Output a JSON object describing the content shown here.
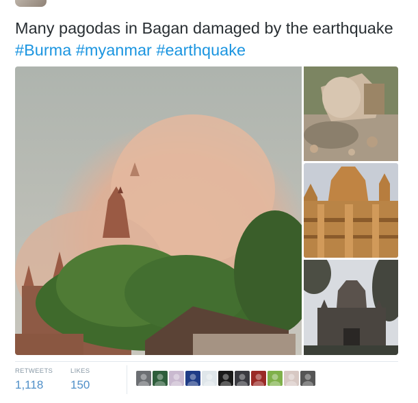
{
  "tweet": {
    "text": {
      "plain": "Many pagodas in Bagan damaged by the earthquake ",
      "hashtags": [
        "#Burma",
        "#myanmar",
        "#earthquake"
      ]
    },
    "photos": [
      {
        "name": "pagoda-dust-cloud-photo"
      },
      {
        "name": "broken-stupa-finial-photo"
      },
      {
        "name": "damaged-pagoda-spires-photo"
      },
      {
        "name": "temple-silhouette-photo"
      }
    ]
  },
  "stats": {
    "retweets": {
      "label": "RETWEETS",
      "value": "1,118"
    },
    "likes": {
      "label": "LIKES",
      "value": "150"
    }
  },
  "likers": [
    {
      "name": "liker-avatar-1",
      "color": "#6c6f73"
    },
    {
      "name": "liker-avatar-2",
      "color": "#2e5e3b"
    },
    {
      "name": "liker-avatar-3",
      "color": "#c9b9cf"
    },
    {
      "name": "liker-avatar-4",
      "color": "#1f3c86"
    },
    {
      "name": "liker-avatar-5",
      "color": "#dfe6ea"
    },
    {
      "name": "liker-avatar-6",
      "color": "#1a1a1a"
    },
    {
      "name": "liker-avatar-7",
      "color": "#3a3a40"
    },
    {
      "name": "liker-avatar-8",
      "color": "#9a2a26"
    },
    {
      "name": "liker-avatar-9",
      "color": "#7fb04a"
    },
    {
      "name": "liker-avatar-10",
      "color": "#d7c8c3"
    },
    {
      "name": "liker-avatar-11",
      "color": "#555555"
    }
  ]
}
